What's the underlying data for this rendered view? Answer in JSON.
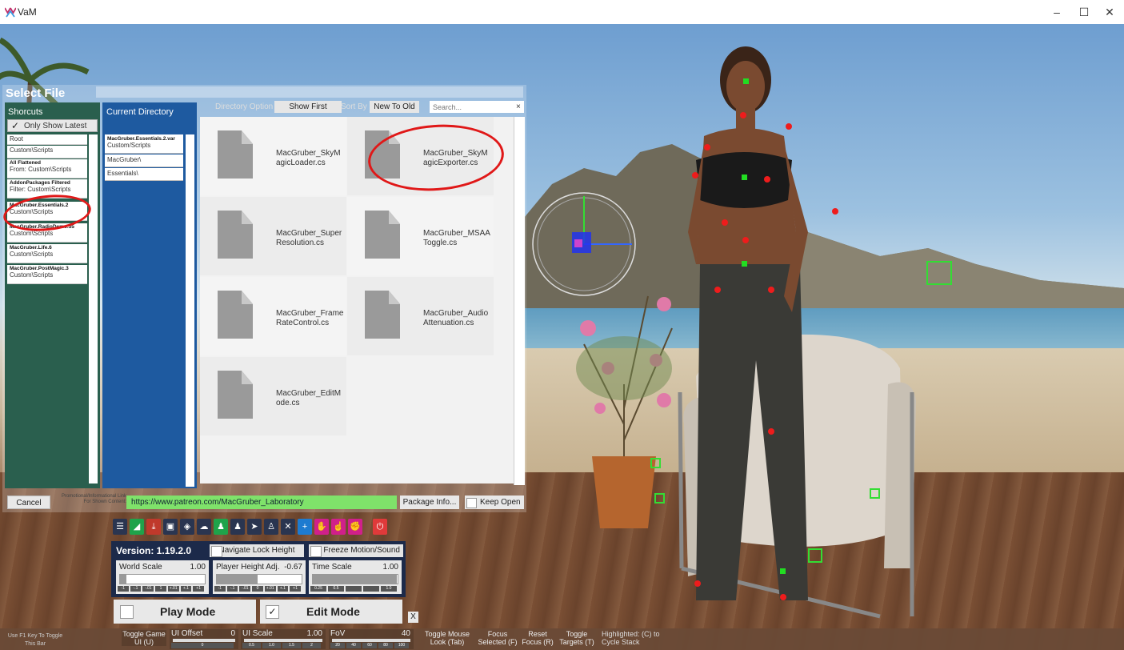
{
  "window": {
    "title": "VaM",
    "minimize": "–",
    "maximize": "☐",
    "close": "✕"
  },
  "select_file": {
    "title": "Select File",
    "shortcuts": {
      "title": "Shorcuts",
      "only_show_latest": "Only Show Latest",
      "items": [
        {
          "title": "",
          "sub": "Root"
        },
        {
          "title": "",
          "sub": "Custom\\Scripts"
        },
        {
          "title": "All Flattened",
          "sub": "From: Custom\\Scripts"
        },
        {
          "title": "AddonPackages Filtered",
          "sub": "Filter: Custom\\Scripts"
        },
        {
          "title": "MacGruber.Essentials.2",
          "sub": "Custom\\Scripts"
        },
        {
          "title": "MacGruber.RadioDemo.55",
          "sub": "Custom\\Scripts"
        },
        {
          "title": "MacGruber.Life.6",
          "sub": "Custom\\Scripts"
        },
        {
          "title": "MacGruber.PostMagic.3",
          "sub": "Custom\\Scripts"
        }
      ]
    },
    "current_directory": {
      "title": "Current Directory",
      "items": [
        {
          "title": "MacGruber.Essentials.2.var",
          "sub": "Custom/Scripts"
        },
        {
          "title": "",
          "sub": "MacGruber\\"
        },
        {
          "title": "",
          "sub": "Essentials\\"
        }
      ]
    },
    "directory_option": "Directory Option",
    "show_first": "Show First",
    "sort_by": "Sort By",
    "sort_value": "New To Old",
    "search_placeholder": "Search...",
    "search_clear": "×",
    "files": [
      "MacGruber_SkyMagicLoader.cs",
      "MacGruber_SkyMagicExporter.cs",
      "MacGruber_SuperResolution.cs",
      "MacGruber_MSAAToggle.cs",
      "MacGruber_FrameRateControl.cs",
      "MacGruber_AudioAttenuation.cs",
      "MacGruber_EditMode.cs"
    ],
    "cancel": "Cancel",
    "promo_label": "Promotional/Informational Link For Shown Content:",
    "promo_url": "https://www.patreon.com/MacGruber_Laboratory",
    "package_info": "Package Info...",
    "keep_open": "Keep Open"
  },
  "main_ui": {
    "version": "Version: 1.19.2.0",
    "navigate_lock_height": "Navigate Lock Height",
    "freeze_motion_sound": "Freeze Motion/Sound",
    "world_scale": {
      "label": "World Scale",
      "value": "1.00",
      "level": 0.08,
      "ticks": [
        "-1",
        "-.1",
        "-.01",
        "1",
        "+.01",
        "+.1",
        "+1"
      ]
    },
    "player_height": {
      "label": "Player Height Adj.",
      "value": "-0.67",
      "level": 0.48,
      "ticks": [
        "-1",
        "-.1",
        "-.01",
        "0",
        "+.01",
        "+.1",
        "+1"
      ]
    },
    "time_scale": {
      "label": "Time Scale",
      "value": "1.00",
      "level": 0.99,
      "ticks": [
        "0.25",
        "0.5",
        "",
        "",
        "1.0"
      ]
    },
    "play_mode": "Play Mode",
    "edit_mode": "Edit Mode",
    "edit_check": "✓",
    "close": "X"
  },
  "toolbar_icons": [
    {
      "name": "menu-icon",
      "color": "#2a3550",
      "glyph": "☰"
    },
    {
      "name": "scene-icon",
      "color": "#1fa34a",
      "glyph": "◢"
    },
    {
      "name": "save-icon",
      "color": "#c0392b",
      "glyph": "⤓"
    },
    {
      "name": "package-icon",
      "color": "#2a3550",
      "glyph": "▣"
    },
    {
      "name": "package-manager-icon",
      "color": "#2a3550",
      "glyph": "◈"
    },
    {
      "name": "cloud-icon",
      "color": "#2a3550",
      "glyph": "☁"
    },
    {
      "name": "person-add-icon",
      "color": "#1fa34a",
      "glyph": "♟"
    },
    {
      "name": "person-settings-icon",
      "color": "#2a3550",
      "glyph": "♟"
    },
    {
      "name": "select-icon",
      "color": "#2a3550",
      "glyph": "➤"
    },
    {
      "name": "person-select-icon",
      "color": "#2a3550",
      "glyph": "♙"
    },
    {
      "name": "tools-icon",
      "color": "#2a3550",
      "glyph": "✕"
    },
    {
      "name": "add-atom-icon",
      "color": "#1e7bd0",
      "glyph": "+"
    },
    {
      "name": "hand-icon",
      "color": "#d0208a",
      "glyph": "✋"
    },
    {
      "name": "hand-point-icon",
      "color": "#d0208a",
      "glyph": "☝"
    },
    {
      "name": "hand-grab-icon",
      "color": "#d0208a",
      "glyph": "✊"
    },
    {
      "name": "power-icon",
      "color": "#e03a3a",
      "glyph": "⏻"
    }
  ],
  "bottom_bar": {
    "f1_hint": "Use F1 Key To Toggle This Bar",
    "toggle_game_ui": "Toggle Game UI (U)",
    "ui_offset": {
      "label": "UI Offset",
      "value": "0",
      "ticks": [
        "0"
      ]
    },
    "ui_scale": {
      "label": "UI Scale",
      "value": "1.00",
      "ticks": [
        "0.5",
        "1.0",
        "1.5",
        "2"
      ]
    },
    "fov": {
      "label": "FoV",
      "value": "40",
      "ticks": [
        "20",
        "40",
        "60",
        "80",
        "100"
      ]
    },
    "toggle_mouse_look": "Toggle Mouse Look (Tab)",
    "focus_selected": "Focus Selected (F)",
    "reset_focus": "Reset Focus (R)",
    "toggle_targets": "Toggle Targets (T)",
    "highlighted": "Highlighted: (C) to Cycle Stack"
  },
  "colors": {
    "accent_green": "#7fe26a",
    "shortcut_panel": "#2a5f4e",
    "directory_panel": "#1e5aa0",
    "annotation_red": "#e01818"
  }
}
